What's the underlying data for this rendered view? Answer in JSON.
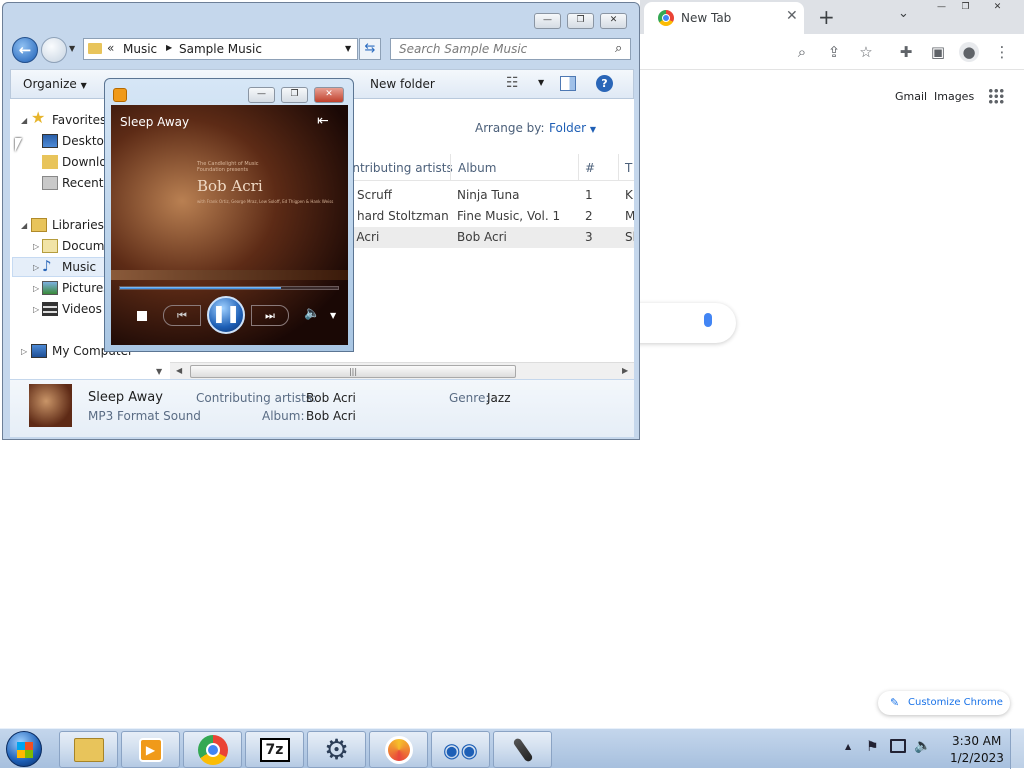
{
  "explorer": {
    "breadcrumb": [
      "Music",
      "Sample Music"
    ],
    "search_placeholder": "Search Sample Music",
    "toolbar": {
      "organize": "Organize",
      "new_folder": "New folder"
    },
    "nav": {
      "favorites": "Favorites",
      "desktop": "Desktop",
      "downloads": "Downlo",
      "recent": "Recent P",
      "libraries": "Libraries",
      "documents": "Docume",
      "music": "Music",
      "pictures": "Pictures",
      "videos": "Videos",
      "computer": "My Computer"
    },
    "arrange": {
      "label": "Arrange by:",
      "value": "Folder"
    },
    "columns": {
      "artists": "ontributing artists",
      "album": "Album",
      "num": "#",
      "title": "T"
    },
    "rows": [
      {
        "artist": "Scruff",
        "album": "Ninja Tuna",
        "num": "1",
        "title": "K"
      },
      {
        "artist": "hard Stoltzman...",
        "album": "Fine Music, Vol. 1",
        "num": "2",
        "title": "M"
      },
      {
        "artist": "b Acri",
        "album": "Bob Acri",
        "num": "3",
        "title": "Sl"
      }
    ],
    "details": {
      "title": "Sleep Away",
      "type": "MP3 Format Sound",
      "artists_label": "Contributing artists:",
      "artists_value": "Bob Acri",
      "album_label": "Album:",
      "album_value": "Bob Acri",
      "genre_label": "Genre:",
      "genre_value": "Jazz"
    }
  },
  "player": {
    "now_playing": "Sleep Away",
    "art_small": "The Candlelight of Music Foundation presents",
    "art_artist": "Bob Acri",
    "art_credits": "with Frank Ortiz, George Mraz, Lew Soloff, Ed Thigpen & Hank Weiss",
    "progress": 0.74
  },
  "chrome": {
    "tab_title": "New Tab",
    "gmail": "Gmail",
    "images": "Images",
    "customize": "Customize Chrome"
  },
  "taskbar": {
    "time": "3:30 AM",
    "date": "1/2/2023",
    "apps": [
      "explorer-icon",
      "media-player-icon",
      "chrome-icon",
      "7zip-icon",
      "settings-gear-icon",
      "cd-burner-icon",
      "eyes-icon",
      "microphone-icon"
    ]
  },
  "colors": {
    "accent": "#1a73e8",
    "explorer_frame": "#c5d7ec",
    "taskbar": "#b3cae6"
  }
}
